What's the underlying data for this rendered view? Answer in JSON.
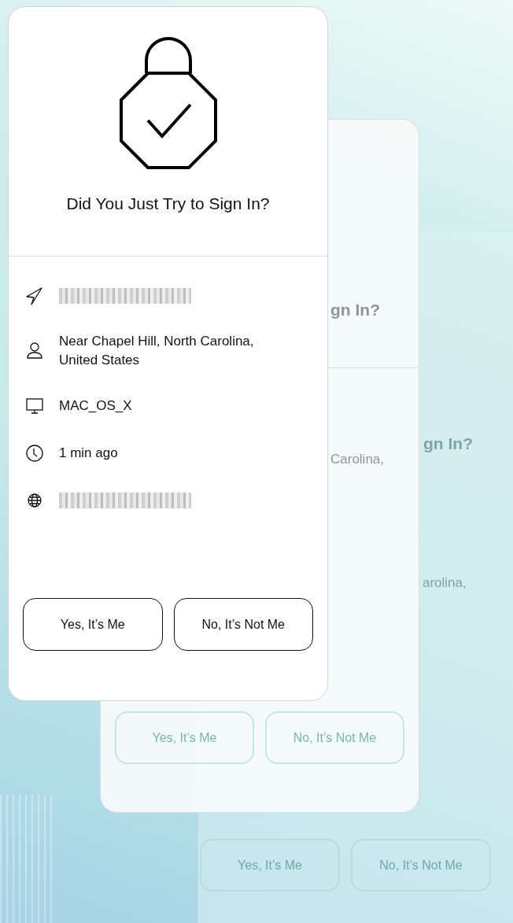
{
  "cards": [
    {
      "kind": "back",
      "title": "gn In?",
      "details": [
        {
          "text": "arolina,"
        }
      ],
      "buttons": [
        "Yes, It’s Me",
        "No, It’s Not Me"
      ]
    },
    {
      "kind": "middle",
      "title": "gn In?",
      "details": [
        {
          "text": "Carolina,"
        }
      ],
      "buttons": [
        "Yes, It’s Me",
        "No, It’s Not Me"
      ]
    },
    {
      "kind": "front",
      "title": "Did You Just Try to Sign In?",
      "details": [
        {
          "kind": "location",
          "redacted": true
        },
        {
          "kind": "person",
          "text": "Near Chapel Hill, North Carolina, United States"
        },
        {
          "kind": "device",
          "text": "MAC_OS_X"
        },
        {
          "kind": "time",
          "text": "1 min ago"
        },
        {
          "kind": "ip",
          "redacted": true
        }
      ],
      "buttons": [
        "Yes, It’s Me",
        "No, It’s Not Me"
      ]
    }
  ]
}
